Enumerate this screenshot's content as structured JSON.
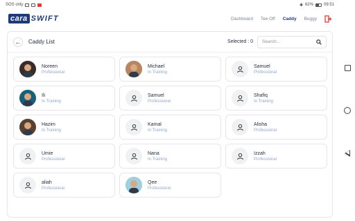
{
  "status_bar": {
    "left_text": "SOS only",
    "battery": "62%",
    "time": "09:51"
  },
  "header": {
    "logo_part1": "cara",
    "logo_part2": "SWIFT",
    "nav": [
      "Dashboard",
      "Tee Off",
      "Caddy",
      "Buggy"
    ],
    "active_nav": "Caddy",
    "accent_color": "#1f3a7a",
    "logout_color": "#e53935"
  },
  "panel": {
    "title": "Caddy List",
    "selected_label": "Selected : 0",
    "search_placeholder": "Search..."
  },
  "caddies": [
    {
      "name": "Noreen",
      "role": "Professional",
      "avatar": "photo"
    },
    {
      "name": "Michael",
      "role": "In Training",
      "avatar": "photo"
    },
    {
      "name": "Samuel",
      "role": "Professional",
      "avatar": "placeholder"
    },
    {
      "name": "Ili",
      "role": "In Training",
      "avatar": "photo"
    },
    {
      "name": "Samuel",
      "role": "Professional",
      "avatar": "placeholder"
    },
    {
      "name": "Shafiq",
      "role": "In Training",
      "avatar": "placeholder"
    },
    {
      "name": "Hazim",
      "role": "In Training",
      "avatar": "photo"
    },
    {
      "name": "Kamal",
      "role": "In Training",
      "avatar": "placeholder"
    },
    {
      "name": "Alisha",
      "role": "Professional",
      "avatar": "placeholder"
    },
    {
      "name": "Umie",
      "role": "Professional",
      "avatar": "placeholder"
    },
    {
      "name": "Nana",
      "role": "In Training",
      "avatar": "placeholder"
    },
    {
      "name": "Izzah",
      "role": "Professional",
      "avatar": "placeholder"
    },
    {
      "name": "aliah",
      "role": "Professional",
      "avatar": "placeholder"
    },
    {
      "name": "Qee",
      "role": "Professional",
      "avatar": "photo"
    }
  ]
}
